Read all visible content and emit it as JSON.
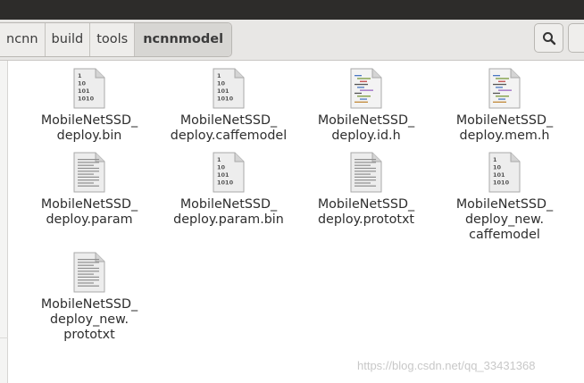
{
  "window": {
    "title_bar_color": "#2d2c2a",
    "accent": "#d7d6d3"
  },
  "breadcrumb": {
    "items": [
      "ncnn",
      "build",
      "tools",
      "ncnnmodel"
    ],
    "active_index": 3
  },
  "toolbar": {
    "search_icon": "search-icon"
  },
  "files": [
    {
      "name": "MobileNetSSD_\ndeploy.bin",
      "type": "binary"
    },
    {
      "name": "MobileNetSSD_\ndeploy.caffemodel",
      "type": "binary"
    },
    {
      "name": "MobileNetSSD_\ndeploy.id.h",
      "type": "code"
    },
    {
      "name": "MobileNetSSD_\ndeploy.mem.h",
      "type": "code"
    },
    {
      "name": "MobileNetSSD_\ndeploy.param",
      "type": "text"
    },
    {
      "name": "MobileNetSSD_\ndeploy.param.bin",
      "type": "binary"
    },
    {
      "name": "MobileNetSSD_\ndeploy.prototxt",
      "type": "text"
    },
    {
      "name": "MobileNetSSD_\ndeploy_new.\ncaffemodel",
      "type": "binary"
    },
    {
      "name": "MobileNetSSD_\ndeploy_new.\nprototxt",
      "type": "text"
    }
  ],
  "binary_icon_text": [
    "1",
    "10",
    "101",
    "1010"
  ],
  "watermark": "https://blog.csdn.net/qq_33431368"
}
